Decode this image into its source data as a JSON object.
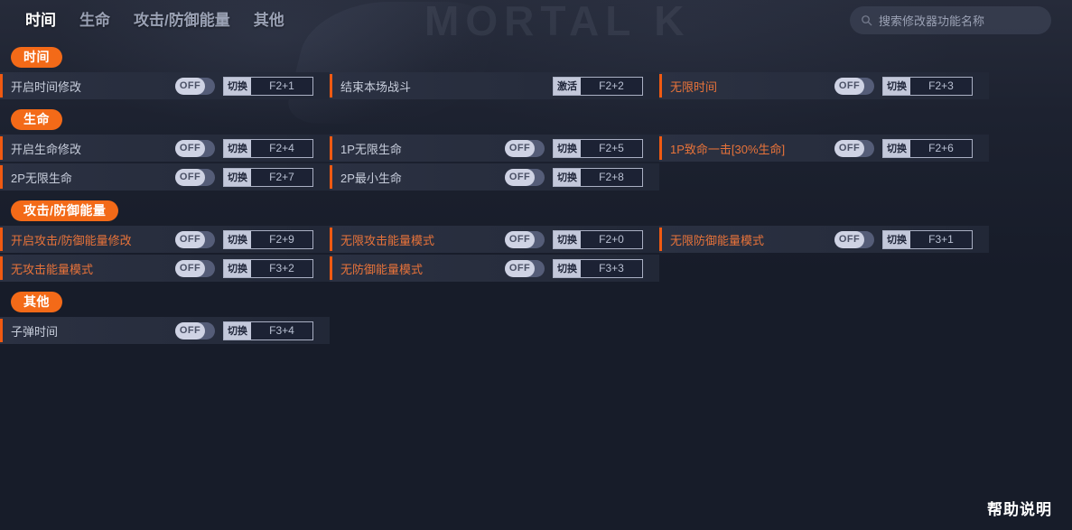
{
  "window": {
    "background_color": "#171c29",
    "accent_color": "#f36a18",
    "watermark_text": "MORTAL K"
  },
  "header": {
    "tabs": [
      {
        "label": "时间",
        "active": true
      },
      {
        "label": "生命",
        "active": false
      },
      {
        "label": "攻击/防御能量",
        "active": false
      },
      {
        "label": "其他",
        "active": false
      }
    ],
    "search": {
      "placeholder": "搜索修改器功能名称",
      "value": "",
      "icon": "search-icon"
    }
  },
  "sections": [
    {
      "title": "时间",
      "items": [
        {
          "label": "开启时间修改",
          "toggle": "OFF",
          "has_toggle": true,
          "mode": "切换",
          "hotkey": "F2+1",
          "accent": false
        },
        {
          "label": "结束本场战斗",
          "toggle": "",
          "has_toggle": false,
          "mode": "激活",
          "hotkey": "F2+2",
          "accent": false
        },
        {
          "label": "无限时间",
          "toggle": "OFF",
          "has_toggle": true,
          "mode": "切换",
          "hotkey": "F2+3",
          "accent": true
        }
      ]
    },
    {
      "title": "生命",
      "items": [
        {
          "label": "开启生命修改",
          "toggle": "OFF",
          "has_toggle": true,
          "mode": "切换",
          "hotkey": "F2+4",
          "accent": false
        },
        {
          "label": "1P无限生命",
          "toggle": "OFF",
          "has_toggle": true,
          "mode": "切换",
          "hotkey": "F2+5",
          "accent": false
        },
        {
          "label": "1P致命一击[30%生命]",
          "toggle": "OFF",
          "has_toggle": true,
          "mode": "切换",
          "hotkey": "F2+6",
          "accent": true
        },
        {
          "label": "2P无限生命",
          "toggle": "OFF",
          "has_toggle": true,
          "mode": "切换",
          "hotkey": "F2+7",
          "accent": false
        },
        {
          "label": "2P最小生命",
          "toggle": "OFF",
          "has_toggle": true,
          "mode": "切换",
          "hotkey": "F2+8",
          "accent": false
        }
      ]
    },
    {
      "title": "攻击/防御能量",
      "items": [
        {
          "label": "开启攻击/防御能量修改",
          "toggle": "OFF",
          "has_toggle": true,
          "mode": "切换",
          "hotkey": "F2+9",
          "accent": true
        },
        {
          "label": "无限攻击能量模式",
          "toggle": "OFF",
          "has_toggle": true,
          "mode": "切换",
          "hotkey": "F2+0",
          "accent": true
        },
        {
          "label": "无限防御能量模式",
          "toggle": "OFF",
          "has_toggle": true,
          "mode": "切换",
          "hotkey": "F3+1",
          "accent": true
        },
        {
          "label": "无攻击能量模式",
          "toggle": "OFF",
          "has_toggle": true,
          "mode": "切换",
          "hotkey": "F3+2",
          "accent": true
        },
        {
          "label": "无防御能量模式",
          "toggle": "OFF",
          "has_toggle": true,
          "mode": "切换",
          "hotkey": "F3+3",
          "accent": true
        }
      ]
    },
    {
      "title": "其他",
      "items": [
        {
          "label": "子弹时间",
          "toggle": "OFF",
          "has_toggle": true,
          "mode": "切换",
          "hotkey": "F3+4",
          "accent": false
        }
      ]
    }
  ],
  "footer": {
    "help_label": "帮助说明"
  }
}
